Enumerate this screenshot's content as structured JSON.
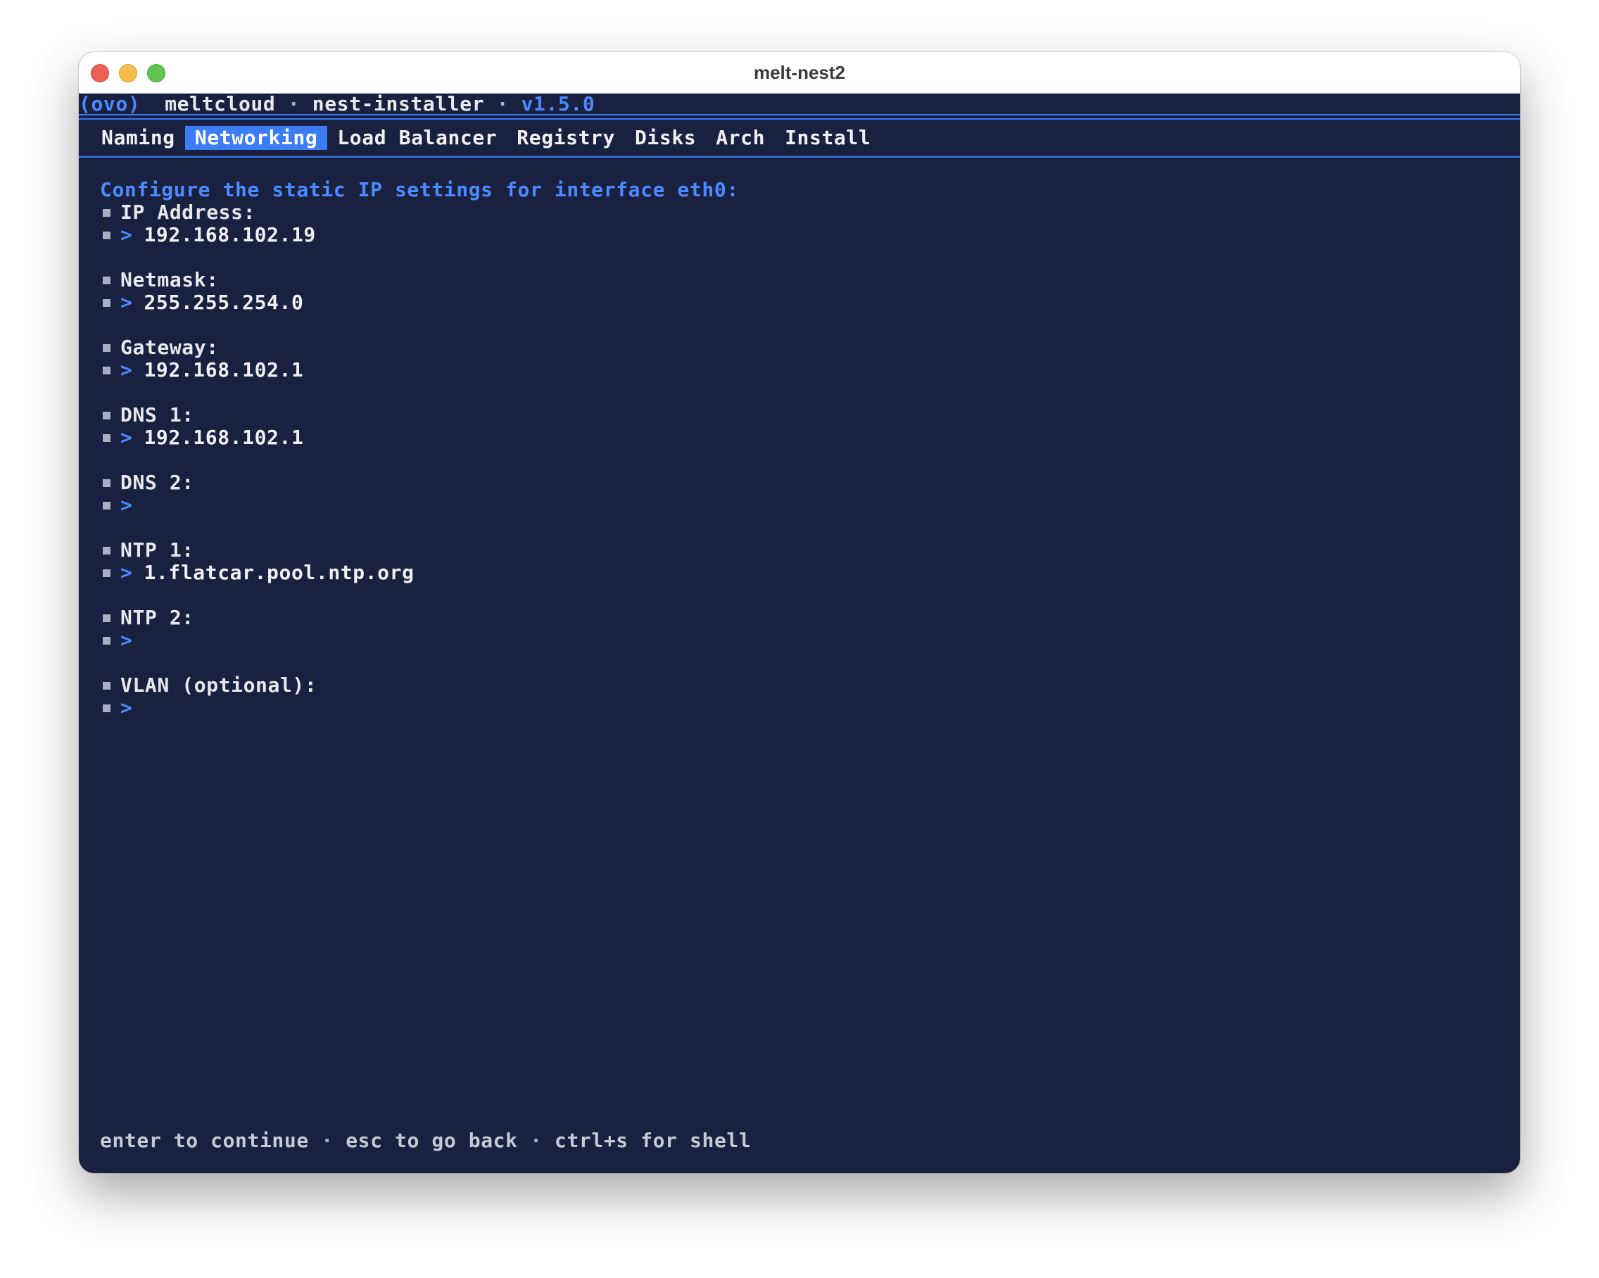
{
  "window": {
    "title": "melt-nest2"
  },
  "header": {
    "logo": "(ovo)",
    "app": "meltcloud",
    "dot1": "·",
    "product": "nest-installer",
    "dot2": "·",
    "version": "v1.5.0"
  },
  "tabs": [
    {
      "label": "Naming",
      "active": false
    },
    {
      "label": "Networking",
      "active": true
    },
    {
      "label": "Load Balancer",
      "active": false
    },
    {
      "label": "Registry",
      "active": false
    },
    {
      "label": "Disks",
      "active": false
    },
    {
      "label": "Arch",
      "active": false
    },
    {
      "label": "Install",
      "active": false
    }
  ],
  "form": {
    "title": "Configure the static IP settings for interface eth0:",
    "prompt_symbol": ">",
    "fields": [
      {
        "label": "IP Address:",
        "value": "192.168.102.19"
      },
      {
        "label": "Netmask:",
        "value": "255.255.254.0"
      },
      {
        "label": "Gateway:",
        "value": "192.168.102.1"
      },
      {
        "label": "DNS 1:",
        "value": "192.168.102.1"
      },
      {
        "label": "DNS 2:",
        "value": ""
      },
      {
        "label": "NTP 1:",
        "value": "1.flatcar.pool.ntp.org"
      },
      {
        "label": "NTP 2:",
        "value": ""
      },
      {
        "label": "VLAN (optional):",
        "value": ""
      }
    ]
  },
  "footer": {
    "hint1": "enter to continue",
    "dot1": "·",
    "hint2": "esc to go back",
    "dot2": "·",
    "hint3": "ctrl+s for shell"
  },
  "colors": {
    "background": "#1a2140",
    "accent": "#3c7cf5",
    "text": "#f0f0f4",
    "muted": "#a9aec2"
  }
}
